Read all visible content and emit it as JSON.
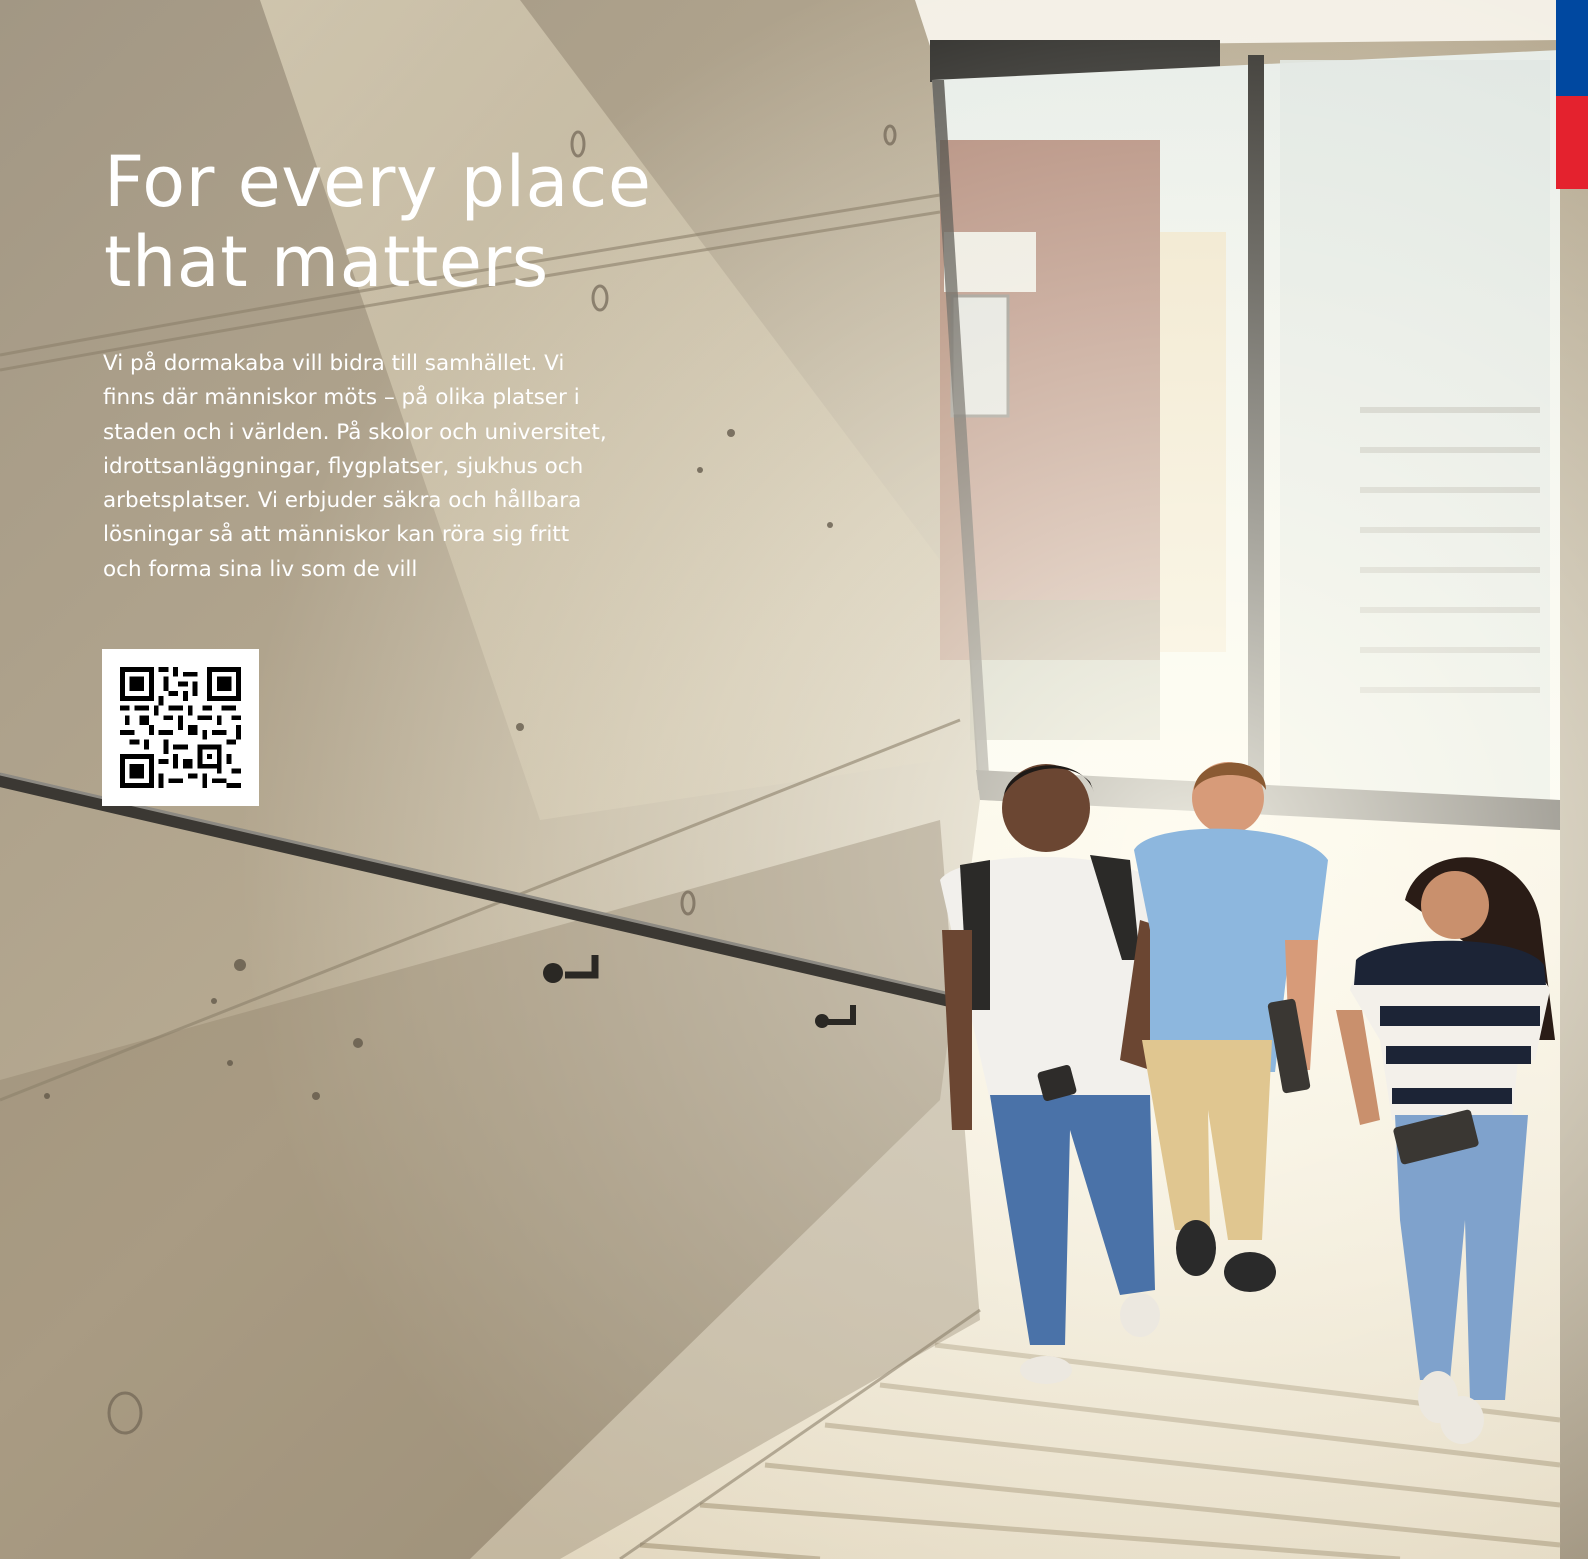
{
  "headline": "For every place\nthat matters",
  "body": "Vi på dormakaba vill bidra till samhället. Vi\nfinns där människor möts – på olika platser i\nstaden och i världen. På skolor och universitet,\nidrottsanläggningar, flygplatser, sjukhus och\narbetsplatser. Vi erbjuder säkra och hållbara\nlösningar så att människor kan röra sig fritt\noch forma sina liv som de vill",
  "colors": {
    "brand_blue": "#0048a0",
    "brand_red": "#e4222e",
    "text": "#ffffff"
  }
}
